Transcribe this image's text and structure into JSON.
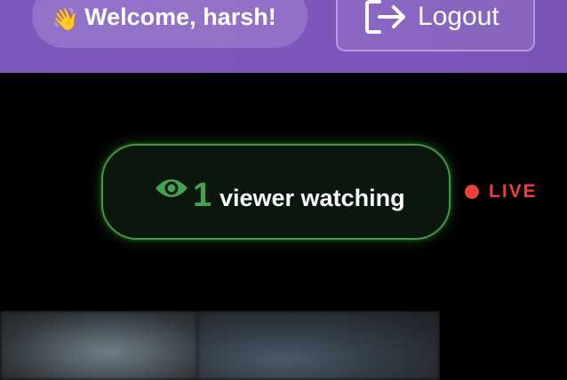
{
  "header": {
    "welcome_emoji": "👋",
    "welcome_text": "Welcome, harsh!",
    "logout_label": "Logout",
    "logout_icon": "logout-icon"
  },
  "viewers": {
    "icon": "eye-icon",
    "count": "1",
    "label": "viewer watching"
  },
  "status": {
    "live_label": "LIVE",
    "live_color": "#ec3f36"
  },
  "colors": {
    "header_gradient_start": "#7b58be",
    "header_gradient_end": "#7a55b7",
    "viewer_accent": "#45a24d",
    "background": "#000000"
  }
}
